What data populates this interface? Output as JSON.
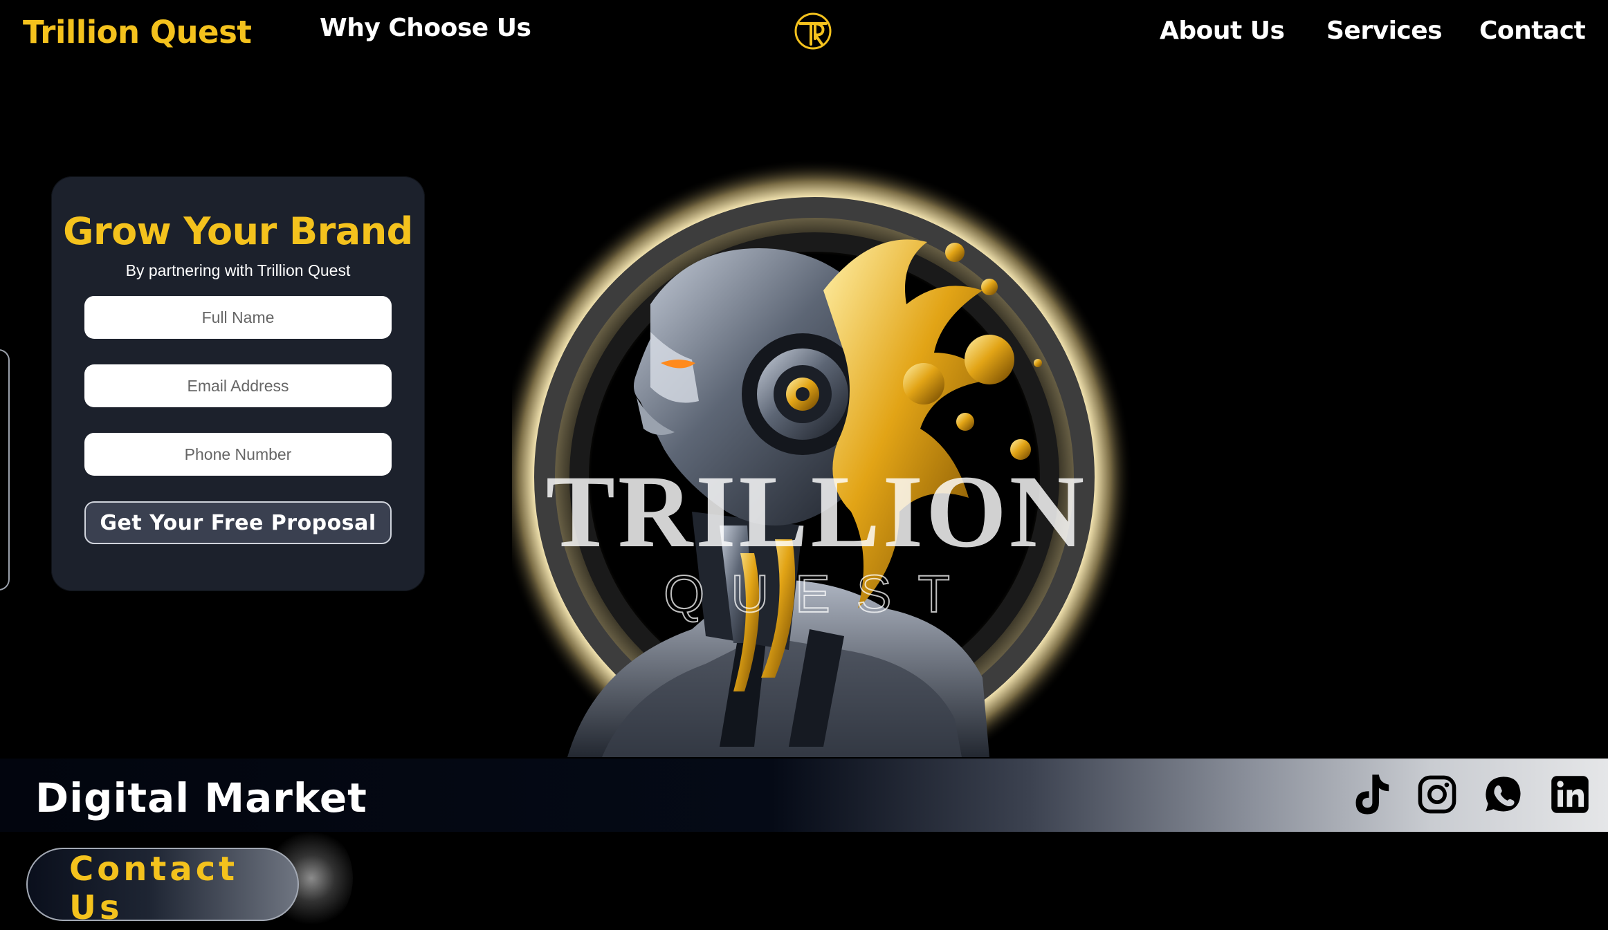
{
  "nav": {
    "brand": "Trillion Quest",
    "links": [
      "Why Choose Us",
      "About Us",
      "Services",
      "Contact"
    ]
  },
  "form": {
    "title": "Grow Your Brand",
    "subtitle": "By partnering with Trillion Quest",
    "name_placeholder": "Full Name",
    "email_placeholder": "Email Address",
    "phone_placeholder": "Phone Number",
    "submit_label": "Get Your Free Proposal"
  },
  "hero": {
    "logo_word": "TRILLION",
    "logo_sub": "QUEST"
  },
  "bottom": {
    "title": "Digital Market",
    "contact_label": "Contact Us",
    "social": [
      "tiktok-icon",
      "instagram-icon",
      "whatsapp-icon",
      "linkedin-icon"
    ]
  },
  "colors": {
    "accent": "#f4c21d",
    "background": "#000000",
    "card": "#1c212c"
  }
}
